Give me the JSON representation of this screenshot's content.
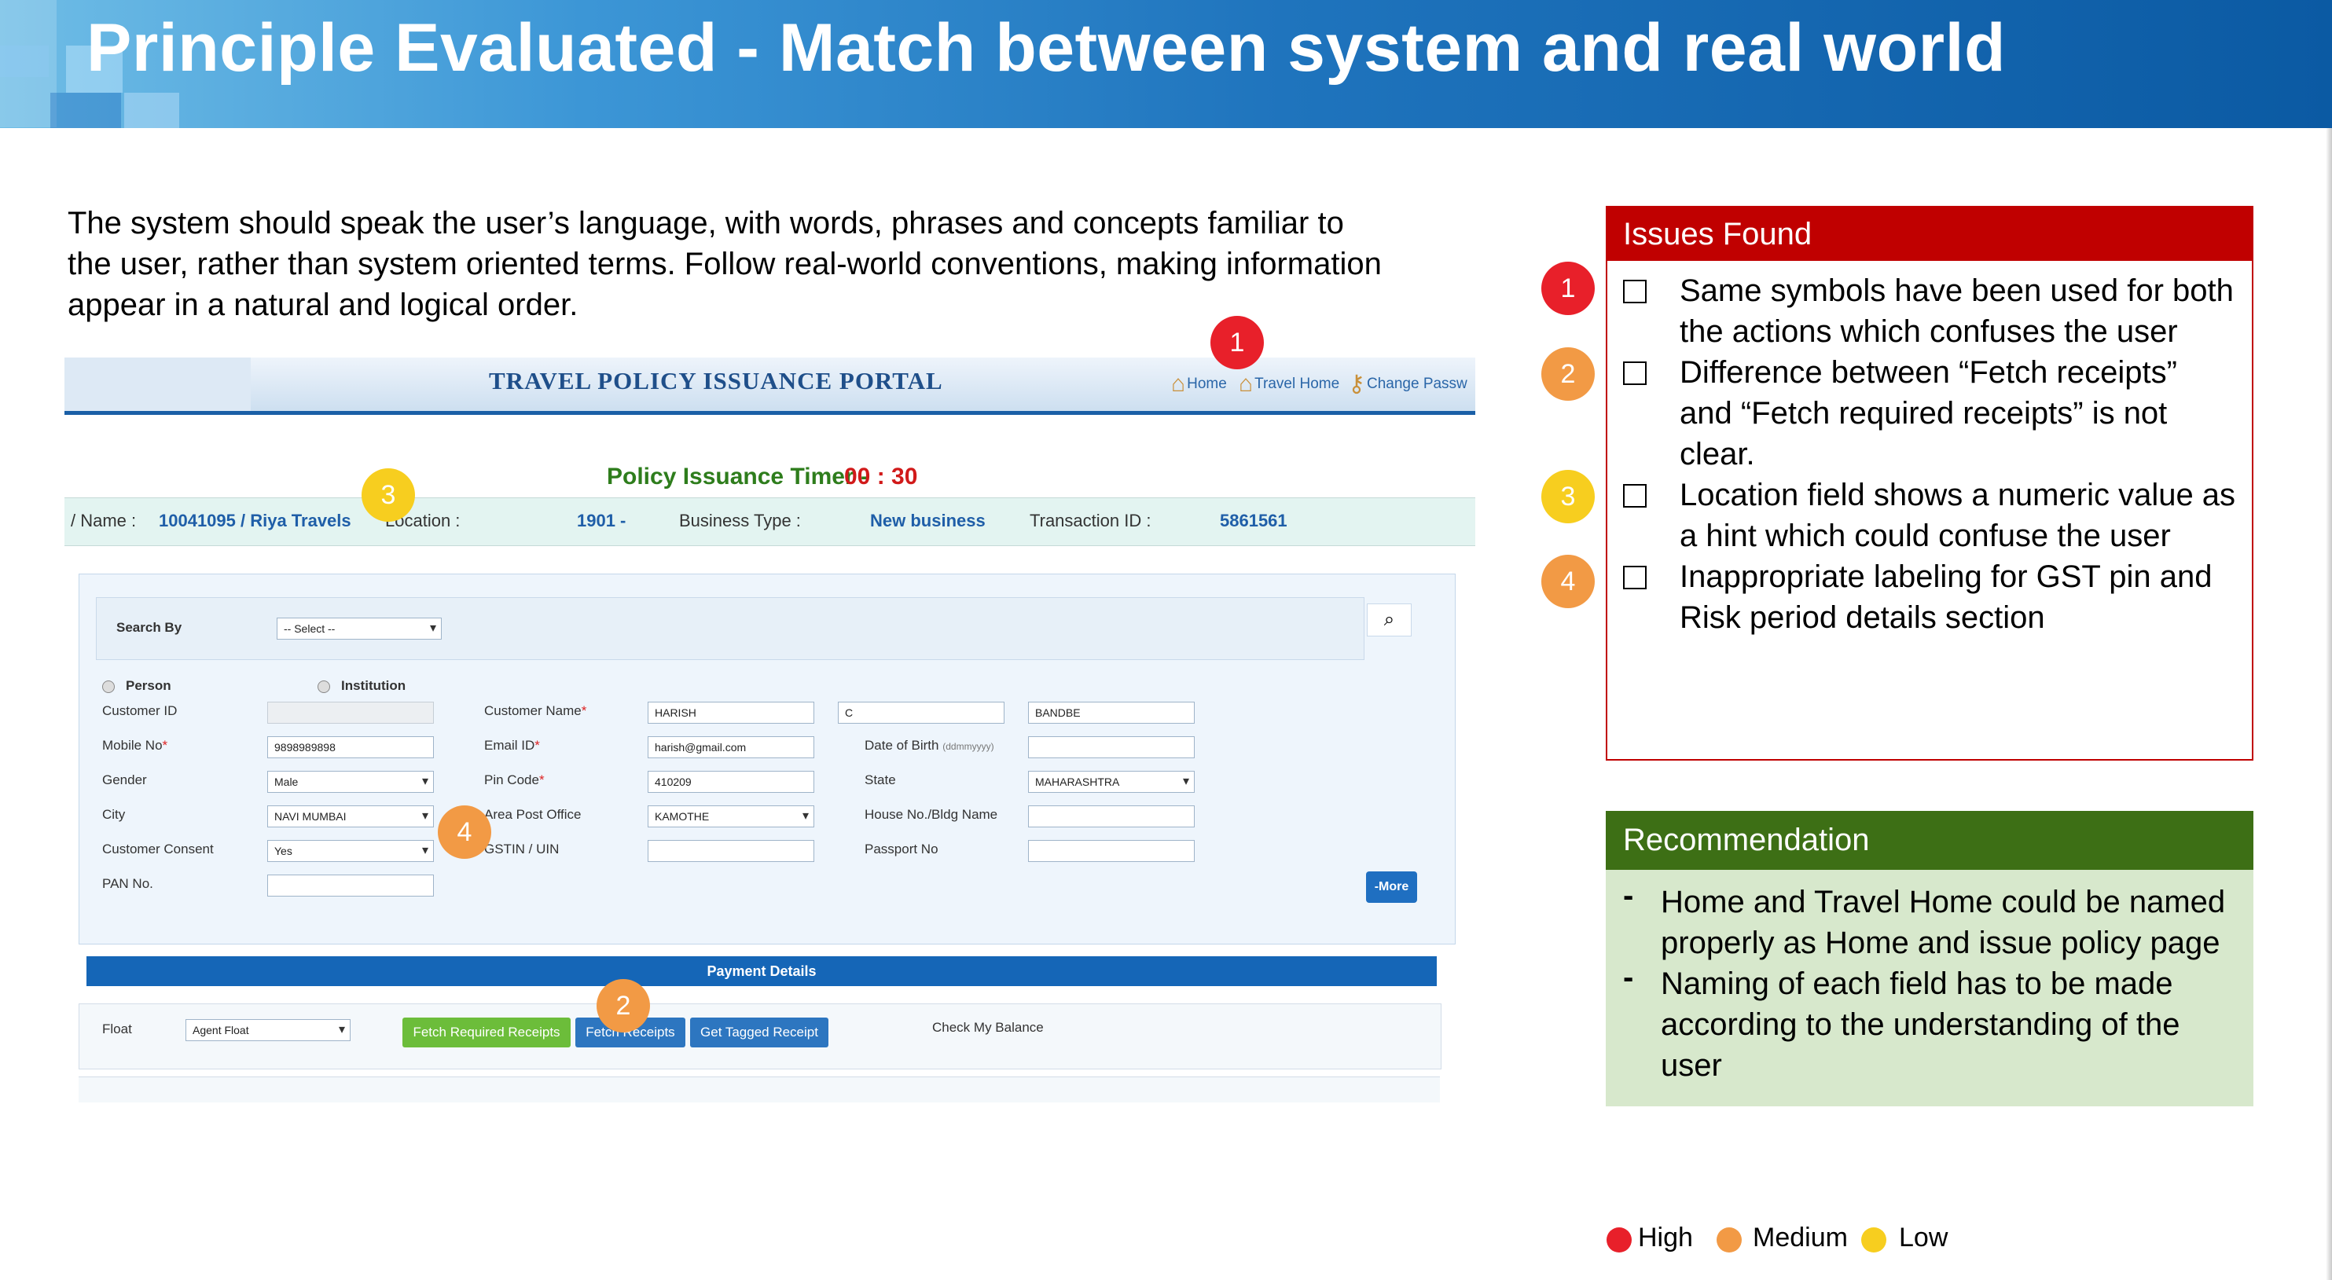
{
  "slide": {
    "title": "Principle Evaluated - Match between system and real world",
    "intro_line1": "The system should speak the user’s language, with words, phrases and concepts familiar to",
    "intro_line2": "the user, rather than system oriented terms. Follow real-world conventions, making information",
    "intro_line3": "appear in a natural and logical order."
  },
  "portal": {
    "title": "TRAVEL POLICY ISSUANCE PORTAL",
    "nav": [
      {
        "label": "Home",
        "icon": "home-icon"
      },
      {
        "label": "Travel Home",
        "icon": "home-icon"
      },
      {
        "label": "Change Passw",
        "icon": "key-icon"
      }
    ],
    "timer_label": "Policy Issuance Timer -",
    "timer_value": "00 : 30",
    "info": {
      "name_label": "/ Name :",
      "name_value": "10041095 / Riya Travels",
      "location_label": "Location :",
      "location_value": "1901 -",
      "business_type_label": "Business Type :",
      "business_type_value": "New business",
      "transaction_label": "Transaction ID :",
      "transaction_value": "5861561"
    },
    "search": {
      "label": "Search By",
      "value": "-- Select --"
    },
    "radios": {
      "person": "Person",
      "institution": "Institution"
    },
    "fields": {
      "customer_id": {
        "label": "Customer ID",
        "value": ""
      },
      "mobile": {
        "label": "Mobile No",
        "value": "9898989898"
      },
      "gender": {
        "label": "Gender",
        "value": "Male"
      },
      "city": {
        "label": "City",
        "value": "NAVI MUMBAI"
      },
      "consent": {
        "label": "Customer Consent",
        "value": "Yes"
      },
      "pan": {
        "label": "PAN No.",
        "value": ""
      },
      "customer_name": {
        "label": "Customer Name",
        "first": "HARISH",
        "middle": "C",
        "last": "BANDBE"
      },
      "email": {
        "label": "Email ID",
        "value": "harish@gmail.com"
      },
      "pin": {
        "label": "Pin Code",
        "value": "410209"
      },
      "area_post": {
        "label": "Area Post Office",
        "value": "KAMOTHE"
      },
      "gstin": {
        "label": "GSTIN / UIN",
        "value": ""
      },
      "dob": {
        "label": "Date of Birth",
        "hint": "(ddmmyyyy)",
        "value": ""
      },
      "state": {
        "label": "State",
        "value": "MAHARASHTRA"
      },
      "house": {
        "label": "House No./Bldg Name",
        "value": ""
      },
      "passport": {
        "label": "Passport No",
        "value": ""
      }
    },
    "more_button": "-More",
    "payment": {
      "header": "Payment Details",
      "float_label": "Float",
      "float_value": "Agent Float",
      "fetch_required": "Fetch Required Receipts",
      "fetch": "Fetch Receipts",
      "tagged": "Get Tagged Receipt",
      "balance": "Check My Balance"
    }
  },
  "markers": [
    "1",
    "2",
    "3",
    "4"
  ],
  "issues": {
    "title": "Issues Found",
    "items": [
      {
        "num": "1",
        "severity": "High",
        "line1": "Same symbols have been used for both",
        "line2": "the actions which confuses the user",
        "line3": ""
      },
      {
        "num": "2",
        "severity": "Medium",
        "line1": "Difference between “Fetch receipts”",
        "line2": "and “Fetch required receipts” is not",
        "line3": "clear."
      },
      {
        "num": "3",
        "severity": "Low",
        "line1": "Location  field shows a numeric value as",
        "line2": "a hint which could confuse the user",
        "line3": ""
      },
      {
        "num": "4",
        "severity": "Medium",
        "line1": "Inappropriate labeling for GST pin and",
        "line2": "Risk period details section",
        "line3": ""
      }
    ]
  },
  "recommendation": {
    "title": "Recommendation",
    "items": [
      {
        "line1": "Home and Travel Home could be named",
        "line2": "properly as Home and issue policy page",
        "line3": ""
      },
      {
        "line1": "Naming of each field has to be made",
        "line2": "according to the understanding of the",
        "line3": "user"
      }
    ]
  },
  "legend": [
    {
      "label": "High",
      "color": "#e8202a"
    },
    {
      "label": "Medium",
      "color": "#f29a45"
    },
    {
      "label": "Low",
      "color": "#f7ce1f"
    }
  ]
}
